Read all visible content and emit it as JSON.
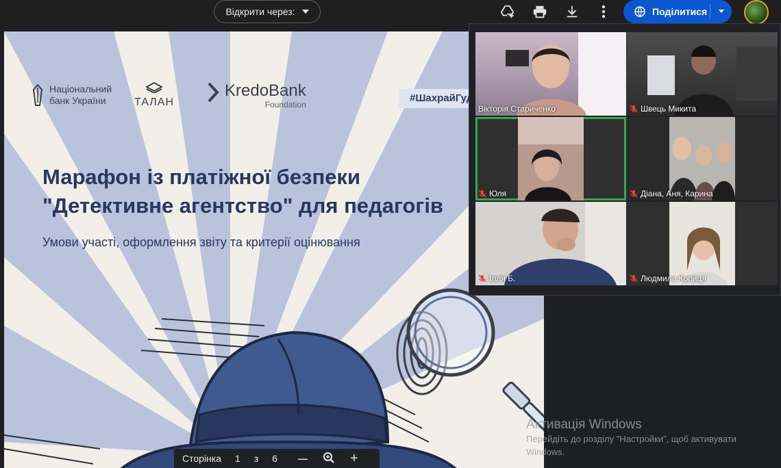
{
  "toolbar": {
    "open_with_label": "Відкрити через:",
    "share_label": "Поділитися",
    "icons": [
      "add-to-drive-icon",
      "print-icon",
      "download-icon",
      "more-vert-icon",
      "globe-icon",
      "chevron-down-icon"
    ]
  },
  "slide": {
    "nbu_logo_line1": "Національний",
    "nbu_logo_line2": "банк України",
    "talan_logo": "ТАЛАН",
    "kredo_name": "KredoBank",
    "kredo_sub": "Foundation",
    "hashtag": "#ШахрайГуд",
    "title_line1": "Марафон із платіжної безпеки",
    "title_line2": "\"Детективне агентство\" для педагогів",
    "subtitle": "Умови участі, оформлення звіту та критерії оцінювання",
    "colors": {
      "title": "#27375e",
      "rays": "#b9c4dc",
      "background": "#f1efe8"
    }
  },
  "pager": {
    "label": "Сторінка",
    "current": "1",
    "of": "з",
    "total": "6",
    "zoom_out": "—",
    "zoom_in": "+"
  },
  "participants": [
    {
      "name": "Вікторія Стариченко",
      "muted": false,
      "active": false
    },
    {
      "name": "Швець Микита",
      "muted": true,
      "active": false
    },
    {
      "name": "Юля",
      "muted": true,
      "active": true
    },
    {
      "name": "Діана, Аня, Карина",
      "muted": true,
      "active": false
    },
    {
      "name": "Ілля Б.",
      "muted": true,
      "active": false
    },
    {
      "name": "Людмила Копиця",
      "muted": true,
      "active": false
    }
  ],
  "watermark": {
    "title": "Активація Windows",
    "text": "Перейдіть до розділу \"Настройки\", щоб активувати Windows."
  }
}
